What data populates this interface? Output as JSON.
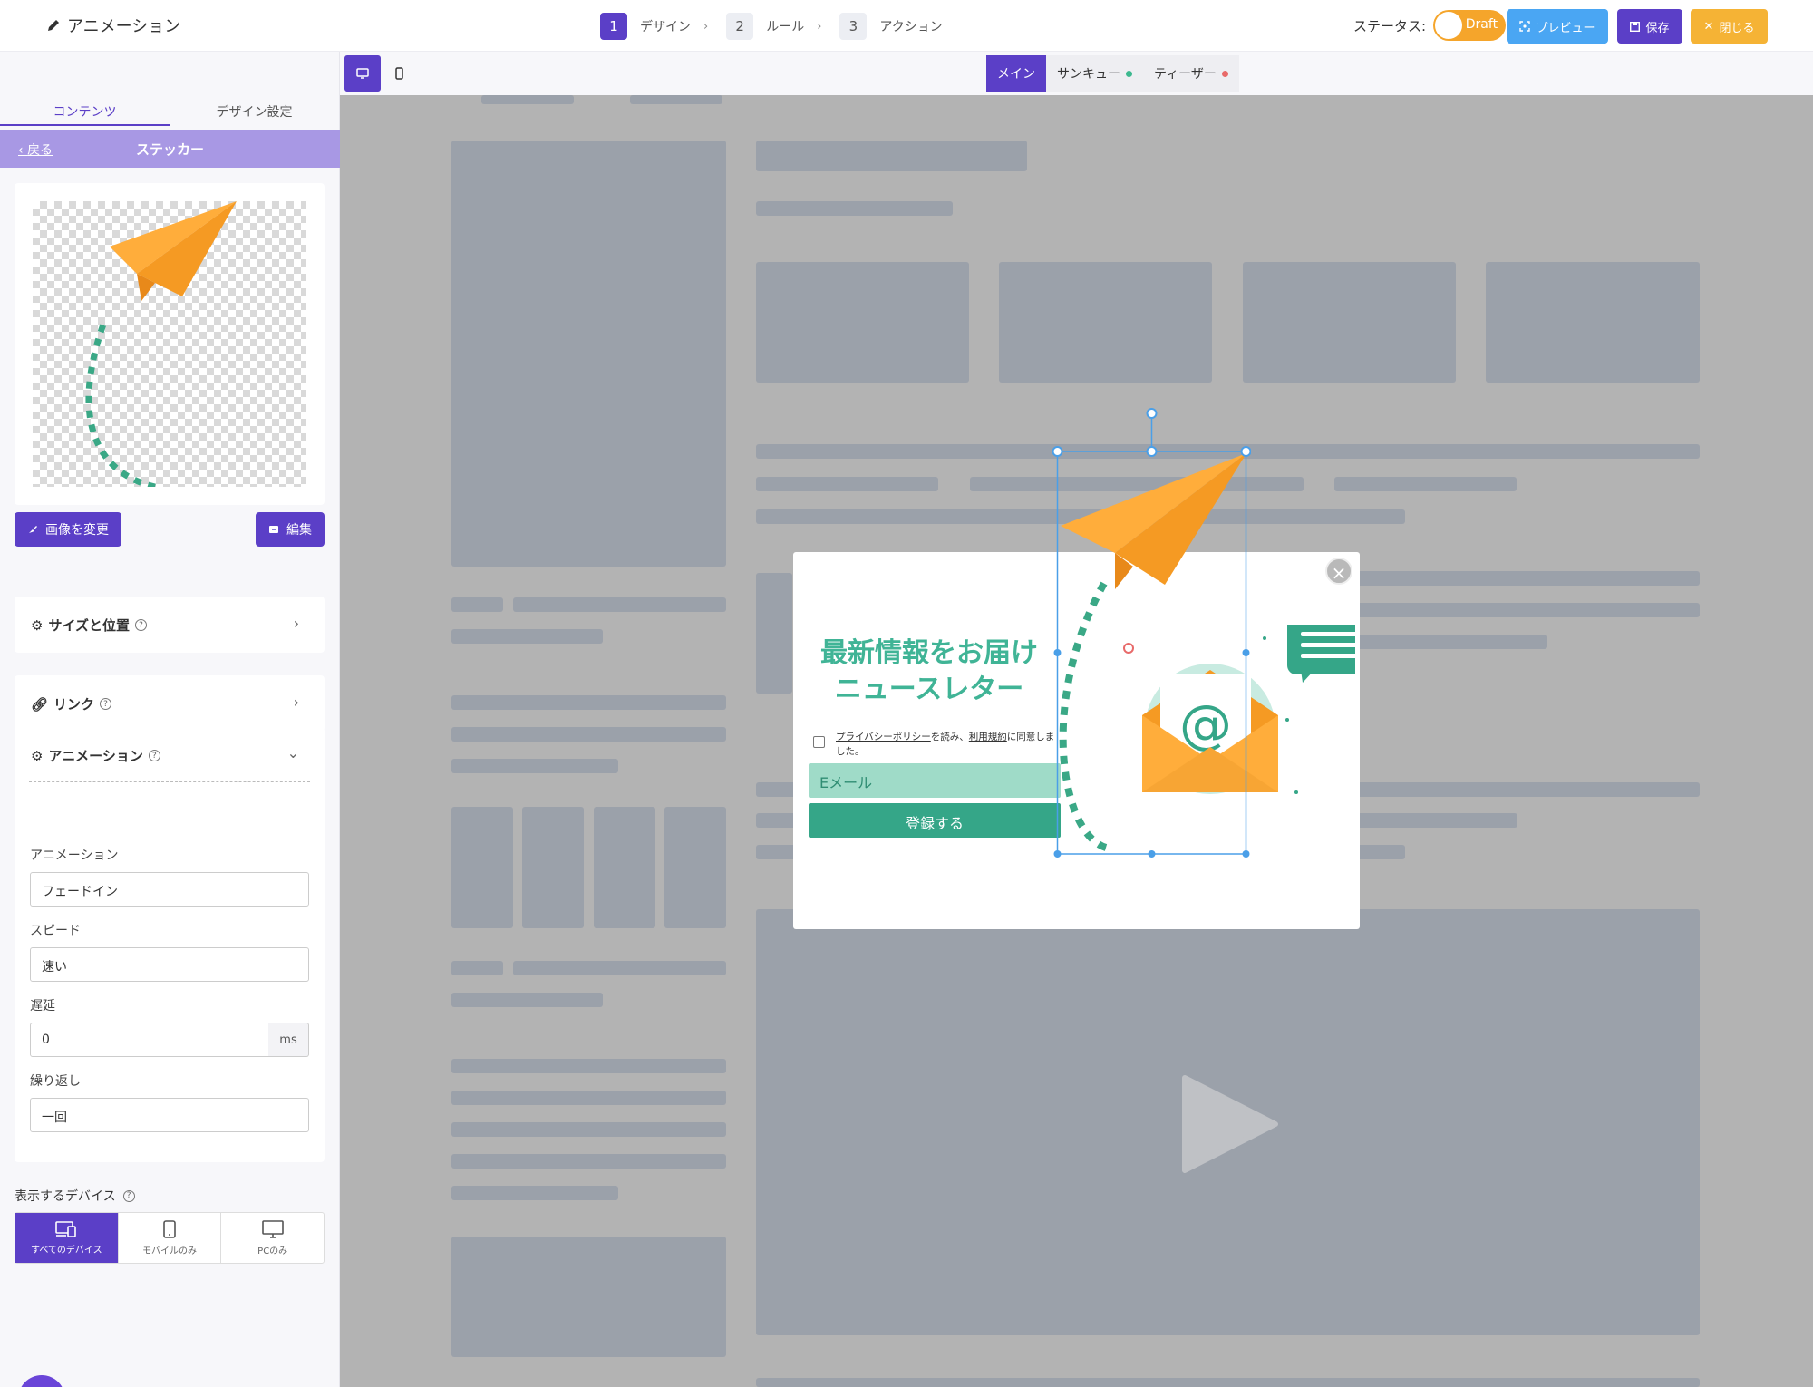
{
  "header": {
    "title": "アニメーション",
    "steps": [
      {
        "num": "1",
        "label": "デザイン"
      },
      {
        "num": "2",
        "label": "ルール"
      },
      {
        "num": "3",
        "label": "アクション"
      }
    ],
    "status_label": "ステータス:",
    "status_value": "Draft",
    "preview_label": "プレビュー",
    "save_label": "保存",
    "close_label": "閉じる"
  },
  "sidebar": {
    "tabs": [
      "コンテンツ",
      "デザイン設定"
    ],
    "back_label": "戻る",
    "section_title": "ステッカー",
    "change_image_label": "画像を変更",
    "edit_label": "編集",
    "size_position_label": "サイズと位置",
    "link_label": "リンク",
    "animation_section_label": "アニメーション",
    "fields": {
      "animation_label": "アニメーション",
      "animation_value": "フェードイン",
      "speed_label": "スピード",
      "speed_value": "速い",
      "delay_label": "遅延",
      "delay_value": "0",
      "delay_unit": "ms",
      "repeat_label": "繰り返し",
      "repeat_value": "一回"
    },
    "devices_label": "表示するデバイス",
    "devices": [
      "すべてのデバイス",
      "モバイルのみ",
      "PCのみ"
    ]
  },
  "canvas": {
    "view_tabs": [
      {
        "label": "メイン"
      },
      {
        "label": "サンキュー",
        "dot_color": "#3cb88f"
      },
      {
        "label": "ティーザー",
        "dot_color": "#e86a6a"
      }
    ]
  },
  "popup": {
    "title_line1": "最新情報をお届け",
    "title_line2": "ニュースレター",
    "privacy_link": "プライバシーポリシー",
    "privacy_mid": "を読み、",
    "terms_link": "利用規約",
    "privacy_end": "に同意しました。",
    "email_placeholder": "Eメール",
    "submit_label": "登録する"
  },
  "colors": {
    "primary": "#5b3fc7",
    "accent_teal": "#35a688",
    "draft_orange": "#f5a52b",
    "preview_blue": "#4aa6f3"
  }
}
